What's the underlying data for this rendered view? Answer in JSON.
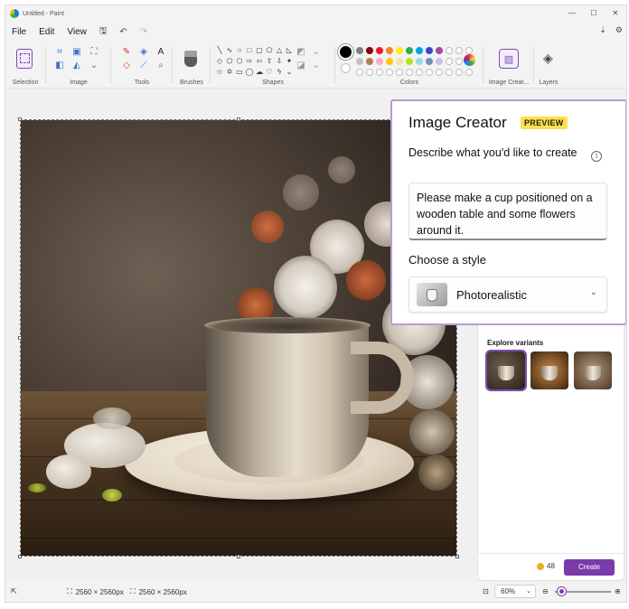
{
  "window": {
    "title": "Untitled - Paint",
    "controls": [
      "—",
      "☐",
      "✕"
    ]
  },
  "menu": {
    "file": "File",
    "edit": "Edit",
    "view": "View"
  },
  "ribbon": {
    "selection": "Selection",
    "image": "Image",
    "tools": "Tools",
    "brushes": "Brushes",
    "shapes": "Shapes",
    "colors": "Colors",
    "image_creator": "Image Creat...",
    "layers": "Layers"
  },
  "palette": {
    "row1": [
      "#000000",
      "#7f7f7f",
      "#880015",
      "#ed1c24",
      "#ff7f27",
      "#fff200",
      "#22b14c",
      "#00a2e8",
      "#3f48cc",
      "#a349a4"
    ],
    "row2": [
      "#ffffff",
      "#c3c3c3",
      "#b97a57",
      "#ffaec9",
      "#ffc90e",
      "#efe4b0",
      "#b5e61d",
      "#99d9ea",
      "#7092be",
      "#c8bfe7"
    ]
  },
  "popup": {
    "title": "Image Creator",
    "badge": "PREVIEW",
    "description": "Describe what you'd like to create",
    "prompt": "Please make a cup positioned on a wooden table and some flowers around it.",
    "style_label": "Choose a style",
    "style_value": "Photorealistic"
  },
  "panel": {
    "explore_label": "Explore variants",
    "credits": "48",
    "create_button": "Create"
  },
  "status": {
    "canvas_size": "2560 × 2560px",
    "selection_size": "2560 × 2560px",
    "zoom": "60%"
  }
}
